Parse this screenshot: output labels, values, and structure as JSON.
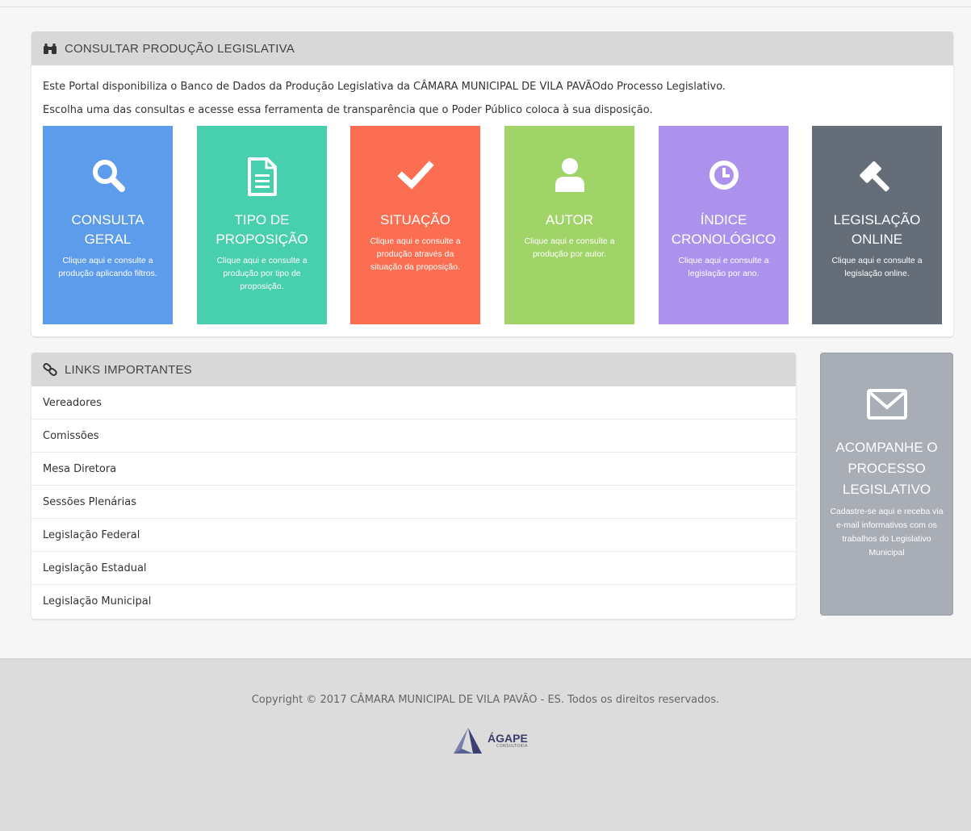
{
  "consultar": {
    "title": "CONSULTAR PRODUÇÃO LEGISLATIVA",
    "icon": "binoculars-icon",
    "intro1": "Este Portal disponibiliza o Banco de Dados da Produção Legislativa da CÂMARA MUNICIPAL DE VILA PAVÃOdo Processo Legislativo.",
    "intro2": "Escolha uma das consultas e acesse essa ferramenta de transparência que o Poder Público coloca à sua disposição.",
    "tiles": [
      {
        "title": "CONSULTA GERAL",
        "desc": "Clique aqui e consulte a produção aplicando filtros.",
        "color": "#5d9ceb",
        "icon": "search-icon"
      },
      {
        "title": "TIPO DE PROPOSIÇÃO",
        "desc": "Clique aqui e consulte a produção por tipo de proposição.",
        "color": "#48cfad",
        "icon": "document-icon"
      },
      {
        "title": "SITUAÇÃO",
        "desc": "Clique aqui e consulte a produção através da situação da proposição.",
        "color": "#fb6e52",
        "icon": "check-icon"
      },
      {
        "title": "AUTOR",
        "desc": "Clique aqui e consulte a produção por autor.",
        "color": "#a0d468",
        "icon": "user-icon"
      },
      {
        "title": "ÍNDICE CRONOLÓGICO",
        "desc": "Clique aqui e consulte a legislação por ano.",
        "color": "#ac92ed",
        "icon": "clock-icon"
      },
      {
        "title": "LEGISLAÇÃO ONLINE",
        "desc": "Clique aqui e consulte a legislação online.",
        "color": "#656d78",
        "icon": "gavel-icon"
      }
    ]
  },
  "links": {
    "title": "LINKS IMPORTANTES",
    "icon": "link-icon",
    "items": [
      "Vereadores",
      "Comissões",
      "Mesa Diretora",
      "Sessões Plenárias",
      "Legislação Federal",
      "Legislação Estadual",
      "Legislação Municipal"
    ]
  },
  "acompanhe": {
    "title": "ACOMPANHE O PROCESSO LEGISLATIVO",
    "desc": "Cadastre-se aqui e receba via e-mail informativos com os trabalhos do Legislativo Municipal",
    "icon": "envelope-icon"
  },
  "footer": {
    "copyright": "Copyright © 2017 CÂMARA MUNICIPAL DE VILA PAVÃO - ES. Todos os direitos reservados.",
    "logo_word": "ÁGAPE",
    "logo_sub": "CONSULTORIA"
  }
}
